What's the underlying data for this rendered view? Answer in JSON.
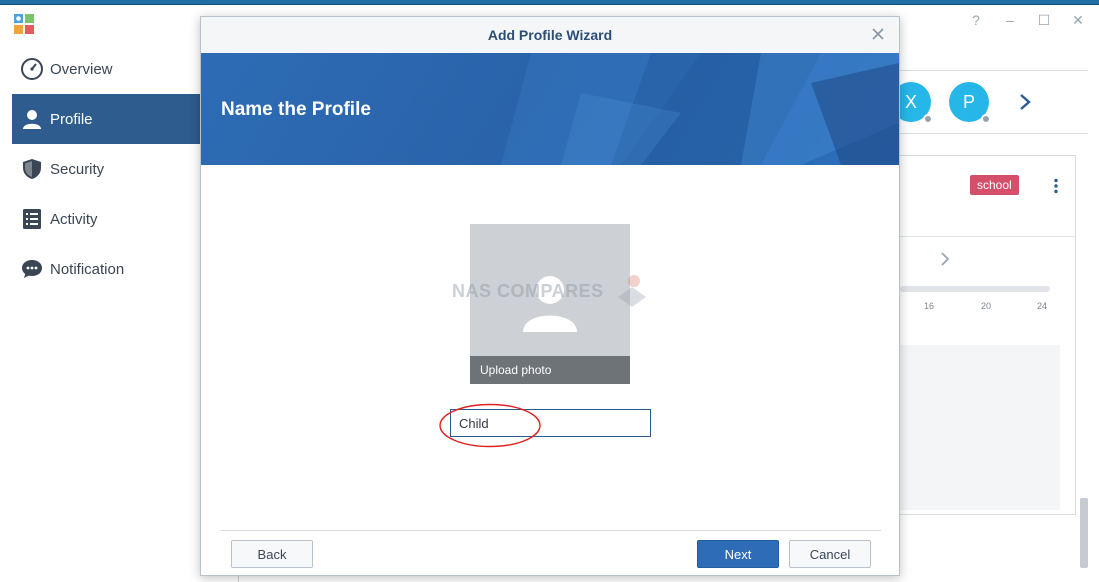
{
  "window": {
    "controls": {
      "help": "?",
      "minimize": "–",
      "maximize": "☐",
      "close": "✕"
    }
  },
  "sidebar": {
    "items": [
      {
        "label": "Overview",
        "icon": "dashboard-icon",
        "active": false
      },
      {
        "label": "Profile",
        "icon": "person-icon",
        "active": true
      },
      {
        "label": "Security",
        "icon": "shield-icon",
        "active": false
      },
      {
        "label": "Activity",
        "icon": "list-icon",
        "active": false
      },
      {
        "label": "Notification",
        "icon": "chat-bubble-icon",
        "active": false
      }
    ]
  },
  "background": {
    "avatars": [
      {
        "initial": "X",
        "color": "#27b6e8"
      },
      {
        "initial": "P",
        "color": "#27b6e8"
      }
    ],
    "tag": {
      "label": "school",
      "color": "#d4506a"
    },
    "timeline_ticks": [
      "16",
      "20",
      "24"
    ]
  },
  "dialog": {
    "title": "Add Profile Wizard",
    "banner_title": "Name the Profile",
    "photo": {
      "upload_label": "Upload photo"
    },
    "watermark": "NAS COMPARES",
    "name_input": {
      "value": "Child",
      "placeholder": ""
    },
    "buttons": {
      "back": "Back",
      "next": "Next",
      "cancel": "Cancel"
    }
  },
  "colors": {
    "accent": "#2e5c8e",
    "banner": "#2d6cb5",
    "primary_button": "#2f6cb7",
    "highlight_circle": "#e02020"
  }
}
